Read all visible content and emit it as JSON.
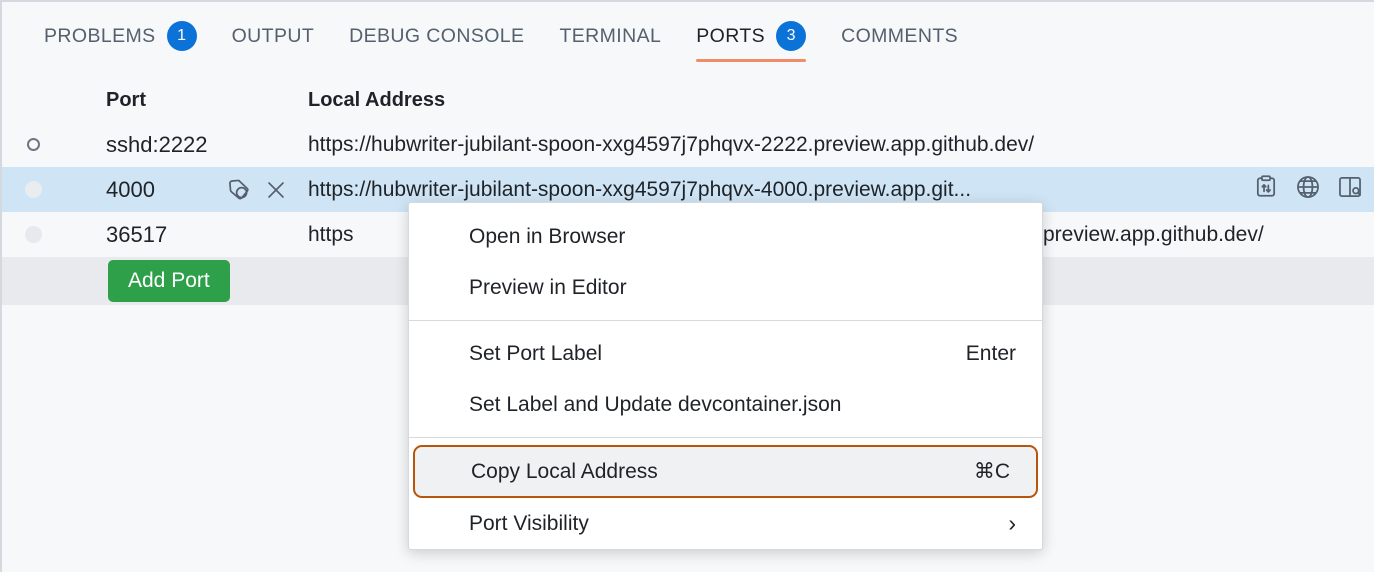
{
  "panel": {
    "tabs": [
      {
        "label": "PROBLEMS",
        "badge": "1",
        "active": false
      },
      {
        "label": "OUTPUT",
        "badge": "",
        "active": false
      },
      {
        "label": "DEBUG CONSOLE",
        "badge": "",
        "active": false
      },
      {
        "label": "TERMINAL",
        "badge": "",
        "active": false
      },
      {
        "label": "PORTS",
        "badge": "3",
        "active": true
      },
      {
        "label": "COMMENTS",
        "badge": "",
        "active": false
      }
    ]
  },
  "table": {
    "headers": {
      "port": "Port",
      "address": "Local Address"
    },
    "rows": [
      {
        "status": "running",
        "port": "sshd:2222",
        "address": "https://hubwriter-jubilant-spoon-xxg4597j7phqvx-2222.preview.app.github.dev/"
      },
      {
        "status": "idle",
        "port": "4000",
        "address": "https://hubwriter-jubilant-spoon-xxg4597j7phqvx-4000.preview.app.git...",
        "selected": true
      },
      {
        "status": "idle",
        "port": "36517",
        "address_start": "https",
        "address_end": "preview.app.github.dev/"
      }
    ],
    "add_port_label": "Add Port"
  },
  "context_menu": {
    "groups": [
      [
        {
          "label": "Open in Browser",
          "accel": "",
          "submenu": false
        },
        {
          "label": "Preview in Editor",
          "accel": "",
          "submenu": false
        }
      ],
      [
        {
          "label": "Set Port Label",
          "accel": "Enter",
          "submenu": false
        },
        {
          "label": "Set Label and Update devcontainer.json",
          "accel": "",
          "submenu": false
        }
      ],
      [
        {
          "label": "Copy Local Address",
          "accel": "⌘C",
          "submenu": false,
          "highlighted": true
        },
        {
          "label": "Port Visibility",
          "accel": "",
          "submenu": true,
          "arrow": "›"
        }
      ]
    ]
  },
  "colors": {
    "accent_tab_underline": "#f08d68",
    "badge_blue": "#0b72d8",
    "add_port_green": "#2ea04a",
    "selected_row": "#cfe5f5",
    "highlight_border": "#b8540c",
    "panel_bg": "#f6f8fa"
  }
}
